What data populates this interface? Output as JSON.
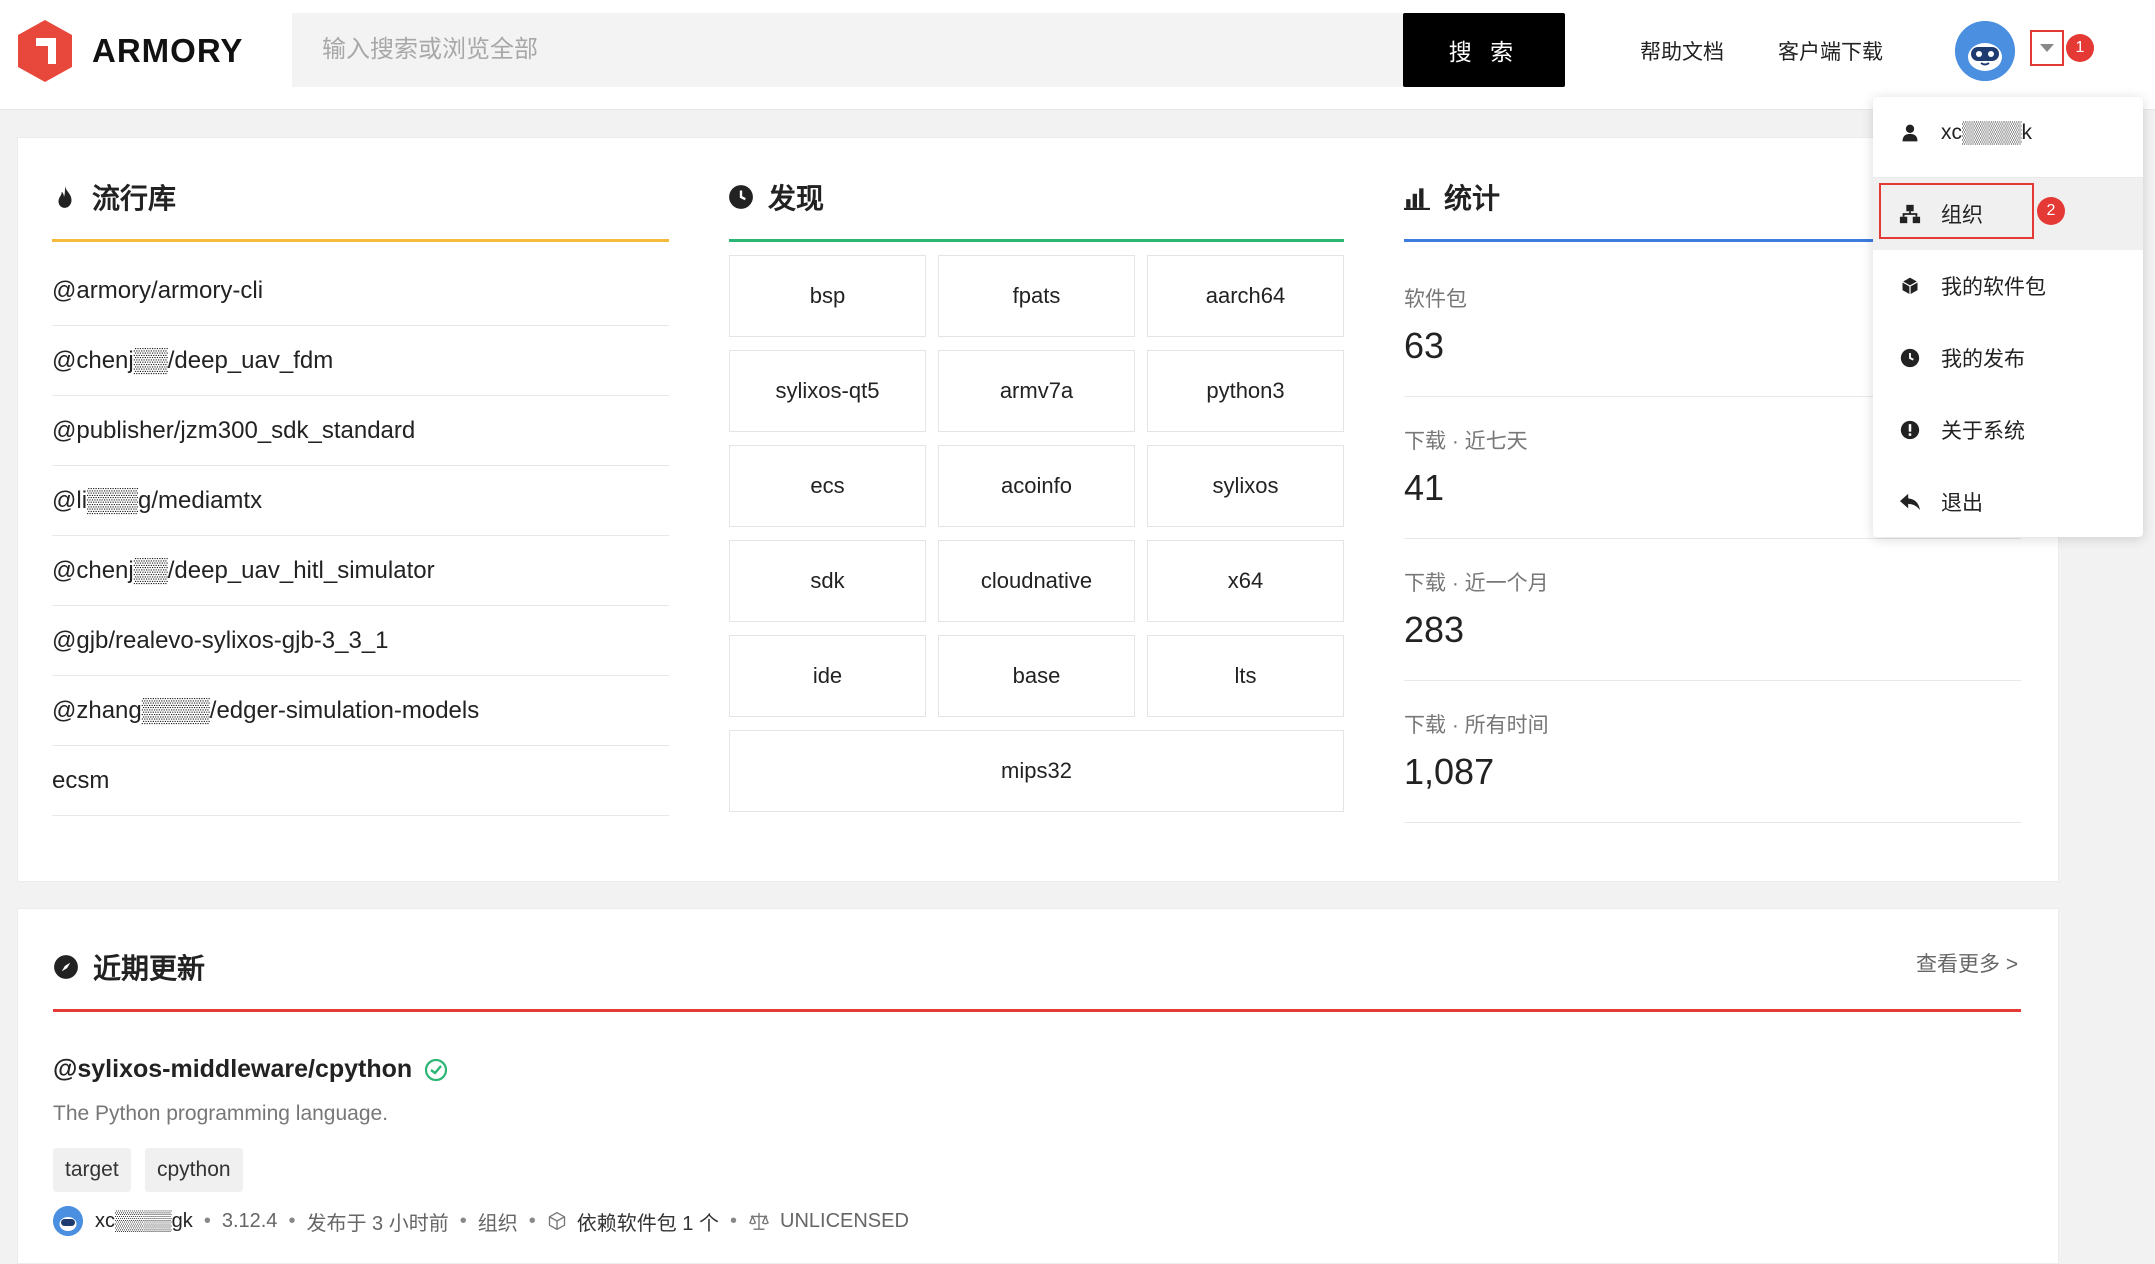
{
  "header": {
    "logo_text": "ARMORY",
    "search_placeholder": "输入搜索或浏览全部",
    "search_button": "搜 索",
    "nav_help": "帮助文档",
    "nav_client": "客户端下载",
    "badge_1": "1"
  },
  "popular": {
    "title": "流行库",
    "items": [
      "@armory/armory-cli",
      "@chenj▒▒/deep_uav_fdm",
      "@publisher/jzm300_sdk_standard",
      "@li▒▒▒g/mediamtx",
      "@chenj▒▒/deep_uav_hitl_simulator",
      "@gjb/realevo-sylixos-gjb-3_3_1",
      "@zhang▒▒▒▒/edger-simulation-models",
      "ecsm"
    ]
  },
  "discover": {
    "title": "发现",
    "tags": [
      "bsp",
      "fpats",
      "aarch64",
      "sylixos-qt5",
      "armv7a",
      "python3",
      "ecs",
      "acoinfo",
      "sylixos",
      "sdk",
      "cloudnative",
      "x64",
      "ide",
      "base",
      "lts"
    ],
    "wide_tag": "mips32"
  },
  "stats": {
    "title": "统计",
    "items": [
      {
        "label": "软件包",
        "value": "63"
      },
      {
        "label": "下载 · 近七天",
        "value": "41"
      },
      {
        "label": "下载 · 近一个月",
        "value": "283"
      },
      {
        "label": "下载 · 所有时间",
        "value": "1,087"
      }
    ]
  },
  "menu": {
    "items": [
      {
        "label": "xc▒▒▒▒k",
        "icon": "user-icon"
      },
      {
        "label": "组织",
        "icon": "organization-icon"
      },
      {
        "label": "我的软件包",
        "icon": "package-icon"
      },
      {
        "label": "我的发布",
        "icon": "clock-icon"
      },
      {
        "label": "关于系统",
        "icon": "info-icon"
      },
      {
        "label": "退出",
        "icon": "logout-icon"
      }
    ],
    "badge_2": "2"
  },
  "recent": {
    "title": "近期更新",
    "more": "查看更多 >",
    "package": {
      "name": "@sylixos-middleware/cpython",
      "description": "The Python programming language.",
      "chips": [
        "target",
        "cpython"
      ],
      "user": "xc▒▒▒▒gk",
      "version": "3.12.4",
      "published": "发布于 3 小时前",
      "org": "组织",
      "deps": "依赖软件包 1 个",
      "license": "UNLICENSED"
    }
  },
  "colors": {
    "popular_underline": "#f5b93b",
    "discover_underline": "#2bb673",
    "stats_underline": "#3d7be0",
    "recent_underline": "#e53935",
    "brand_red": "#e8483b"
  }
}
